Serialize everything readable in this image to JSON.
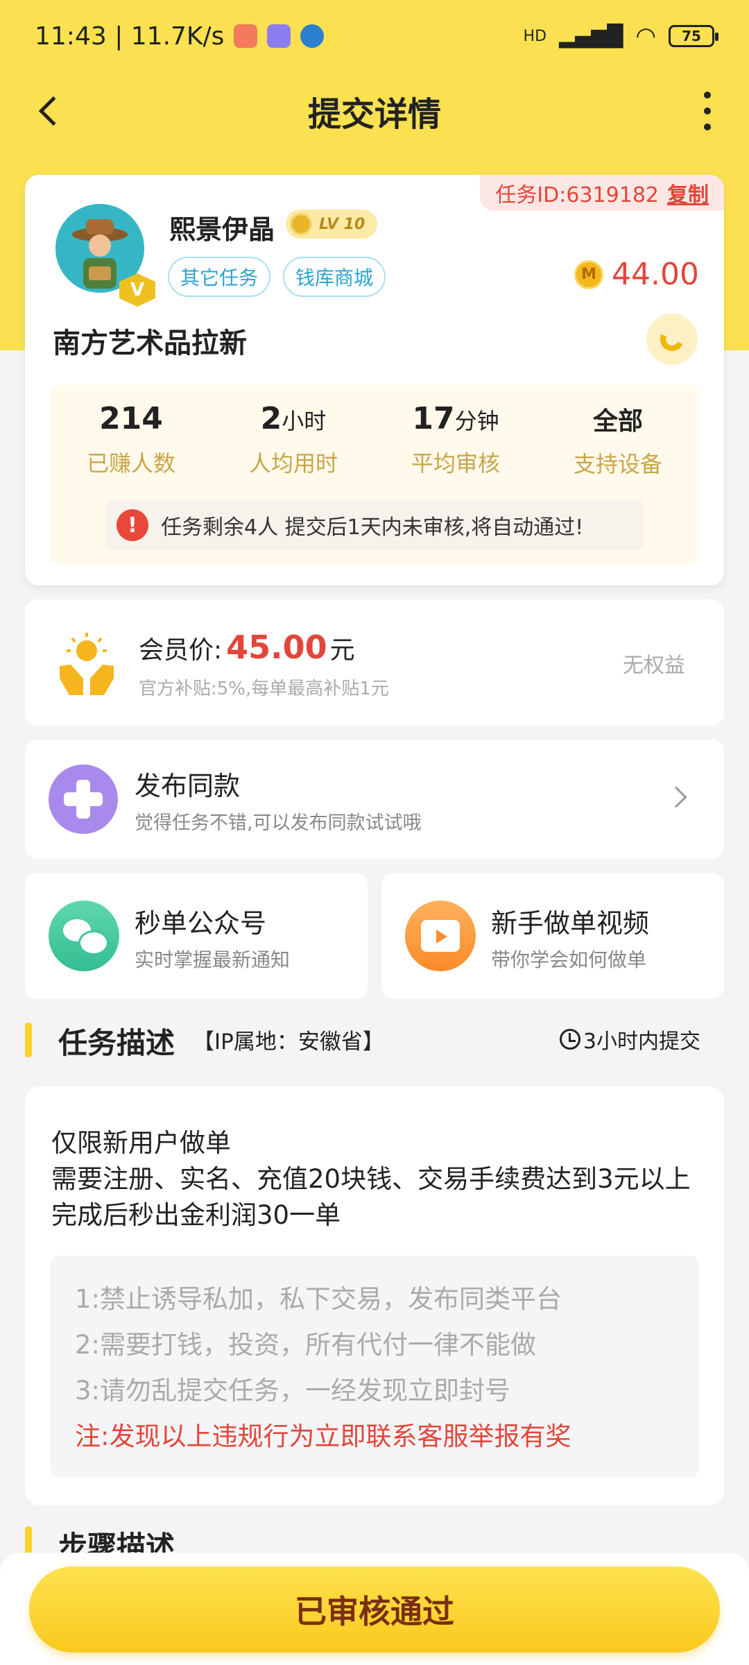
{
  "status_bar": {
    "time_speed": "11:43 | 11.7K/s",
    "network": "HD",
    "battery": "75"
  },
  "header": {
    "title": "提交详情"
  },
  "task": {
    "id_label": "任务ID:6319182",
    "copy_label": "复制",
    "user_name": "熙景伊晶",
    "level": "LV 10",
    "vip_badge": "V",
    "tags": [
      "其它任务",
      "钱库商城"
    ],
    "coin_symbol": "M",
    "reward": "44.00",
    "name": "南方艺术品拉新"
  },
  "stats": [
    {
      "num": "214",
      "unit": "",
      "label": "已赚人数"
    },
    {
      "num": "2",
      "unit": "小时",
      "label": "人均用时"
    },
    {
      "num": "17",
      "unit": "分钟",
      "label": "平均审核"
    },
    {
      "num": "全部",
      "unit": "",
      "label": "支持设备"
    }
  ],
  "notice": {
    "icon": "!",
    "text": "任务剩余4人  提交后1天内未审核,将自动通过!"
  },
  "member": {
    "label": "会员价:",
    "price": "45.00",
    "unit": "元",
    "subtitle": "官方补贴:5%,每单最高补贴1元",
    "right_text": "无权益"
  },
  "publish": {
    "title": "发布同款",
    "subtitle": "觉得任务不错,可以发布同款试试哦"
  },
  "cards": [
    {
      "title": "秒单公众号",
      "subtitle": "实时掌握最新通知",
      "color": "#3fc59c"
    },
    {
      "title": "新手做单视频",
      "subtitle": "带你学会如何做单",
      "color": "#fb8e32"
    }
  ],
  "description": {
    "heading": "任务描述",
    "ip": "【IP属地：安徽省】",
    "deadline": "3小时内提交",
    "text_lines": [
      "仅限新用户做单",
      "需要注册、实名、充值20块钱、交易手续费达到3元以上完成后秒出金利润30一单"
    ],
    "rules": [
      "1:禁止诱导私加，私下交易，发布同类平台",
      "2:需要打钱，投资，所有代付一律不能做",
      "3:请勿乱提交任务，一经发现立即封号"
    ],
    "warning": "注:发现以上违规行为立即联系客服举报有奖"
  },
  "steps": {
    "heading": "步骤描述"
  },
  "bottom_button": "已审核通过"
}
